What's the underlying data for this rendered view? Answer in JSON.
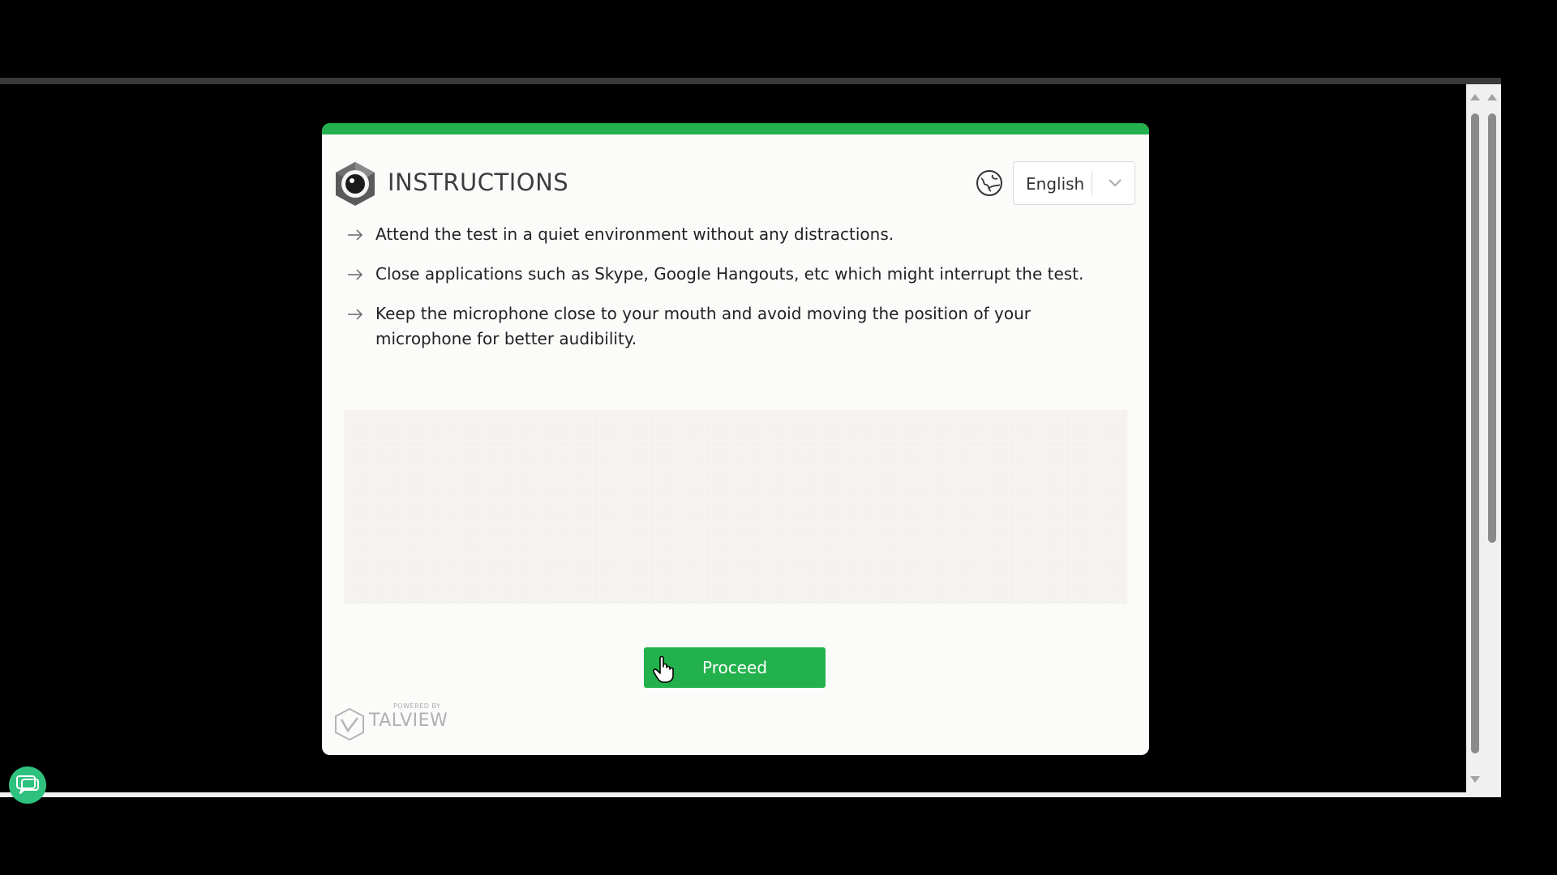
{
  "header": {
    "title": "INSTRUCTIONS",
    "language": {
      "selected": "English"
    }
  },
  "instructions": [
    "Attend the test in a quiet environment without any distractions.",
    "Close applications such as Skype, Google Hangouts, etc which might interrupt the test.",
    "Keep the microphone close to your mouth and avoid moving the position of your microphone for better audibility."
  ],
  "actions": {
    "proceed_label": "Proceed"
  },
  "footer": {
    "powered_by": "POWERED BY",
    "brand": "TALVIEW"
  },
  "colors": {
    "accent": "#22b14c",
    "card_background": "#fbfbfa",
    "media_placeholder": "#f3efec",
    "chat_button": "#2ec27e"
  },
  "icons": {
    "header_logo": "camera-lens-icon",
    "language": "globe-icon",
    "dropdown": "chevron-down-icon",
    "bullet": "arrow-right-icon",
    "cursor": "hand-pointer-icon",
    "chat": "chat-bubble-icon"
  }
}
